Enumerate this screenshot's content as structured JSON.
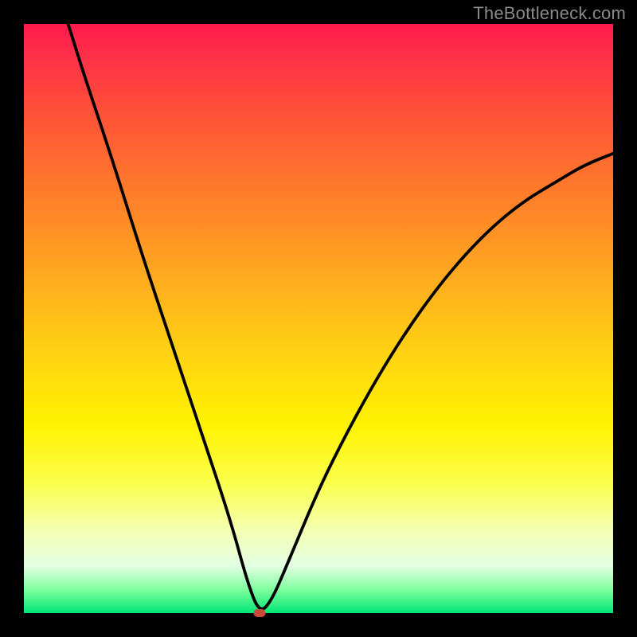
{
  "watermark": {
    "text": "TheBottleneck.com"
  },
  "colors": {
    "frame": "#000000",
    "curve": "#000000",
    "marker": "#c94a3b"
  },
  "chart_data": {
    "type": "line",
    "title": "",
    "xlabel": "",
    "ylabel": "",
    "xlim": [
      0,
      100
    ],
    "ylim": [
      0,
      100
    ],
    "grid": false,
    "legend": false,
    "note": "V-shaped bottleneck curve over warm-to-green vertical gradient. x increases left→right, y increases bottom→top. Values estimated from pixel positions.",
    "series": [
      {
        "name": "curve",
        "x": [
          7.5,
          10,
          15,
          20,
          25,
          30,
          35,
          38,
          40,
          42,
          45,
          50,
          55,
          60,
          65,
          70,
          75,
          80,
          85,
          90,
          95,
          100
        ],
        "values": [
          100,
          92,
          77,
          61,
          46,
          31,
          16,
          5,
          0,
          2,
          9,
          21,
          31,
          40,
          48,
          55,
          61,
          66,
          70,
          73,
          76,
          78
        ]
      }
    ],
    "marker": {
      "x": 40,
      "y": 0
    }
  }
}
